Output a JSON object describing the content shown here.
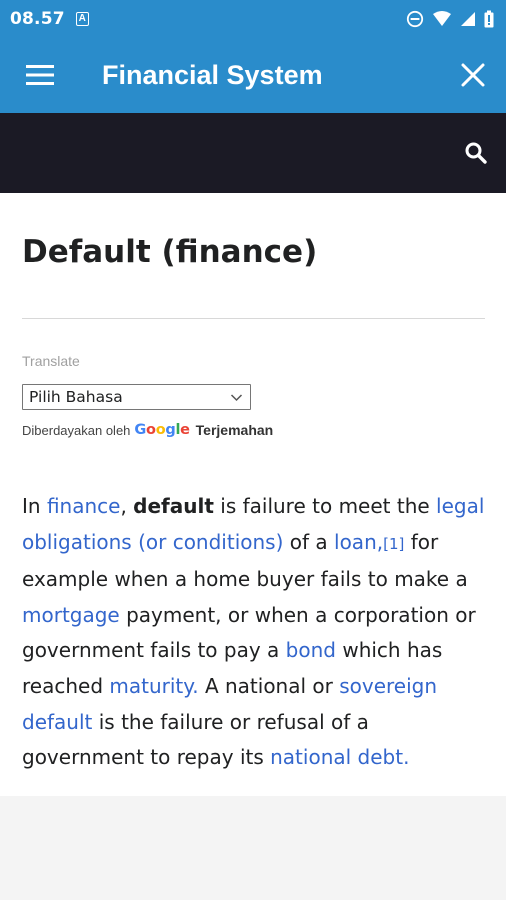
{
  "status_bar": {
    "time": "08.57",
    "notification_badge": "A"
  },
  "app_bar": {
    "title": "Financial System"
  },
  "article": {
    "title": "Default (finance)",
    "translate": {
      "label": "Translate",
      "selected_language": "Pilih Bahasa",
      "powered_by": "Diberdayakan oleh",
      "google_letters": [
        "G",
        "o",
        "o",
        "g",
        "l",
        "e"
      ],
      "google_colors": [
        "#4285F4",
        "#EA4335",
        "#FBBC05",
        "#4285F4",
        "#34A853",
        "#EA4335"
      ],
      "service": "Terjemahan"
    },
    "paragraph": {
      "t1": "In ",
      "l_finance": "finance",
      "t2": ", ",
      "b_default": "default",
      "t3": " is failure to meet the ",
      "l_legal": "legal obligations (or conditions)",
      "t4": " of a ",
      "l_loan": "loan,",
      "l_ref": "[1]",
      "t5": " for example when a home buyer fails to make a ",
      "l_mortgage": "mortgage",
      "t6": " payment, or when a corporation or government fails to pay a ",
      "l_bond": "bond",
      "t7": " which has reached ",
      "l_maturity": "maturity.",
      "t8": " A national or ",
      "l_sovereign": "sovereign default",
      "t9": " is the failure or refusal of a government to repay its ",
      "l_debt": "national debt."
    }
  },
  "colors": {
    "app_bar": "#2a8ccb",
    "search_bar": "#1b1a25",
    "link": "#3366cc",
    "text": "#202122"
  },
  "icons": [
    "a-notification-icon",
    "do-not-disturb-icon",
    "wifi-icon",
    "signal-icon",
    "battery-icon",
    "menu-icon",
    "close-icon",
    "search-icon",
    "chevron-down-icon"
  ]
}
